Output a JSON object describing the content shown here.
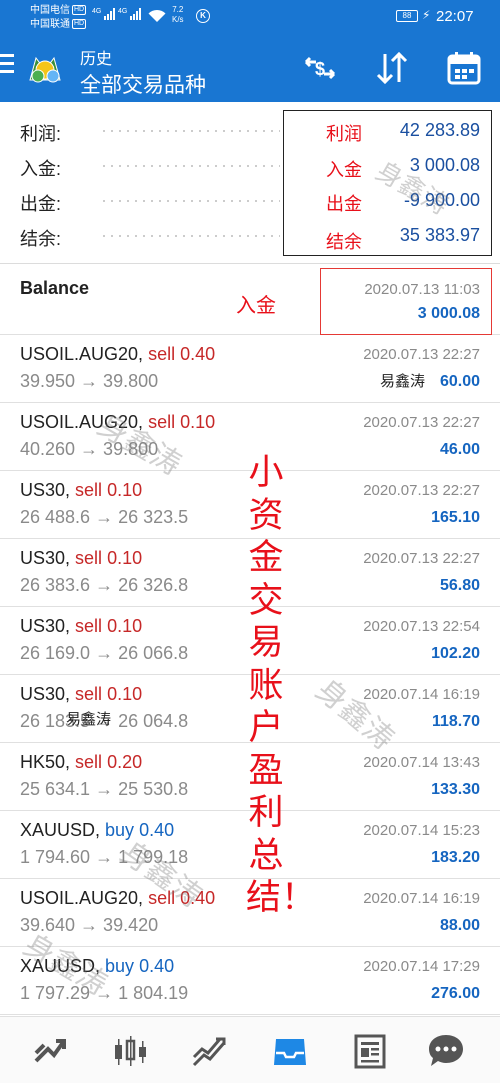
{
  "status_bar": {
    "carrier1": "中国电信",
    "carrier2": "中国联通",
    "hd": "HD",
    "net1": "4G",
    "net2": "4G",
    "speed_value": "7.2",
    "speed_unit": "K/s",
    "k_badge": "K",
    "battery": "88",
    "time": "22:07"
  },
  "app_bar": {
    "subtitle": "历史",
    "title": "全部交易品种"
  },
  "summary": [
    {
      "label": "利润:",
      "value": "42 283.89"
    },
    {
      "label": "入金:",
      "value": "3 000.08"
    },
    {
      "label": "出金:",
      "value": "-9 900.00"
    },
    {
      "label": "结余:",
      "value": "35 383.97"
    }
  ],
  "annotations": {
    "summary_labels": [
      "利润",
      "入金",
      "出金",
      "结余"
    ],
    "balance_label": "入金",
    "vertical_text": "小资金交易账户盈利总结！",
    "watermark": "身鑫涛",
    "signature": "易鑫涛"
  },
  "balance": {
    "title": "Balance",
    "time": "2020.07.13 11:03",
    "amount": "3 000.08"
  },
  "deals": [
    {
      "symbol": "USOIL.AUG20,",
      "side": "sell",
      "volume": "0.40",
      "price": "39.950 → 39.800",
      "time": "2020.07.13 22:27",
      "profit": "60.00"
    },
    {
      "symbol": "USOIL.AUG20,",
      "side": "sell",
      "volume": "0.10",
      "price": "40.260 → 39.800",
      "time": "2020.07.13 22:27",
      "profit": "46.00"
    },
    {
      "symbol": "US30,",
      "side": "sell",
      "volume": "0.10",
      "price": "26 488.6 → 26 323.5",
      "time": "2020.07.13 22:27",
      "profit": "165.10"
    },
    {
      "symbol": "US30,",
      "side": "sell",
      "volume": "0.10",
      "price": "26 383.6 → 26 326.8",
      "time": "2020.07.13 22:27",
      "profit": "56.80"
    },
    {
      "symbol": "US30,",
      "side": "sell",
      "volume": "0.10",
      "price": "26 169.0 → 26 066.8",
      "time": "2020.07.13 22:54",
      "profit": "102.20"
    },
    {
      "symbol": "US30,",
      "side": "sell",
      "volume": "0.10",
      "price": "26 183.5 → 26 064.8",
      "time": "2020.07.14 16:19",
      "profit": "118.70"
    },
    {
      "symbol": "HK50,",
      "side": "sell",
      "volume": "0.20",
      "price": "25 634.1 → 25 530.8",
      "time": "2020.07.14 13:43",
      "profit": "133.30"
    },
    {
      "symbol": "XAUUSD,",
      "side": "buy",
      "volume": "0.40",
      "price": "1 794.60 → 1 799.18",
      "time": "2020.07.14 15:23",
      "profit": "183.20"
    },
    {
      "symbol": "USOIL.AUG20,",
      "side": "sell",
      "volume": "0.40",
      "price": "39.640 → 39.420",
      "time": "2020.07.14 16:19",
      "profit": "88.00"
    },
    {
      "symbol": "XAUUSD,",
      "side": "buy",
      "volume": "0.40",
      "price": "1 797.29 → 1 804.19",
      "time": "2020.07.14 17:29",
      "profit": "276.00"
    }
  ],
  "icons": {
    "app_bar": [
      "menu-icon",
      "app-logo-icon",
      "currency-exchange-icon",
      "sort-icon",
      "calendar-icon"
    ],
    "bottom_nav": [
      "quotes-icon",
      "chart-icon",
      "trade-icon",
      "history-icon",
      "news-icon",
      "chat-icon"
    ]
  },
  "colors": {
    "primary": "#1976d2",
    "sell": "#c62828",
    "buy": "#1565c0",
    "profit": "#1565c0",
    "annotation": "#e8101a",
    "nav_active": "#1e88e5",
    "nav_inactive": "#555555"
  }
}
